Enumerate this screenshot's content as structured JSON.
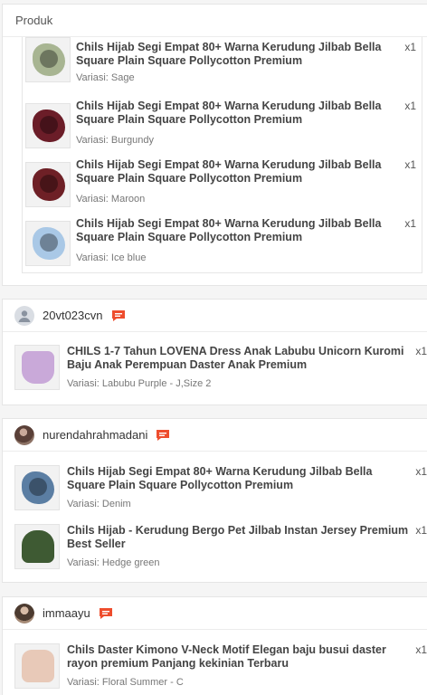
{
  "product_section": {
    "title": "Produk",
    "items": [
      {
        "name": "Chils Hijab Segi Empat 80+ Warna Kerudung Jilbab Bella Square Plain Square Pollycotton Premium",
        "variant": "Variasi: Sage",
        "qty": "x1",
        "color": "#a8b592"
      },
      {
        "name": "Chils Hijab Segi Empat 80+ Warna Kerudung Jilbab Bella Square Plain Square Pollycotton Premium",
        "variant": "Variasi: Burgundy",
        "qty": "x1",
        "color": "#6b1d28"
      },
      {
        "name": "Chils Hijab Segi Empat 80+ Warna Kerudung Jilbab Bella Square Plain Square Pollycotton Premium",
        "variant": "Variasi: Maroon",
        "qty": "x1",
        "color": "#6e2026"
      },
      {
        "name": "Chils Hijab Segi Empat 80+ Warna Kerudung Jilbab Bella Square Plain Square Pollycotton Premium",
        "variant": "Variasi: Ice blue",
        "qty": "x1",
        "color": "#a9c8e6"
      }
    ]
  },
  "orders": [
    {
      "username": "20vt023cvn",
      "items": [
        {
          "name": "CHILS 1-7 Tahun LOVENA Dress Anak Labubu Unicorn Kuromi Baju Anak Perempuan Daster Anak Premium",
          "variant": "Variasi: Labubu Purple - J,Size 2",
          "qty": "x1",
          "color": "#c9a9d9"
        }
      ]
    },
    {
      "username": "nurendahrahmadani",
      "items": [
        {
          "name": "Chils Hijab Segi Empat 80+ Warna Kerudung Jilbab Bella Square Plain Square Pollycotton Premium",
          "variant": "Variasi: Denim",
          "qty": "x1",
          "color": "#5b7ea3"
        },
        {
          "name": "Chils Hijab - Kerudung Bergo Pet Jilbab Instan Jersey Premium Best Seller",
          "variant": "Variasi: Hedge green",
          "qty": "x1",
          "color": "#3e5a33"
        }
      ]
    },
    {
      "username": "immaayu",
      "items": [
        {
          "name": "Chils Daster Kimono V-Neck Motif Elegan baju busui daster rayon premium Panjang kekinian Terbaru",
          "variant": "Variasi: Floral Summer - C",
          "qty": "x1",
          "color": "#e8c9b8"
        }
      ]
    }
  ],
  "colors": {
    "accent": "#ee4d2d",
    "text": "#333333",
    "muted": "#777777",
    "border": "#e5e5e5"
  },
  "icons": {
    "chat": "chat-bubble-icon",
    "avatar_default": "user-silhouette-icon"
  }
}
